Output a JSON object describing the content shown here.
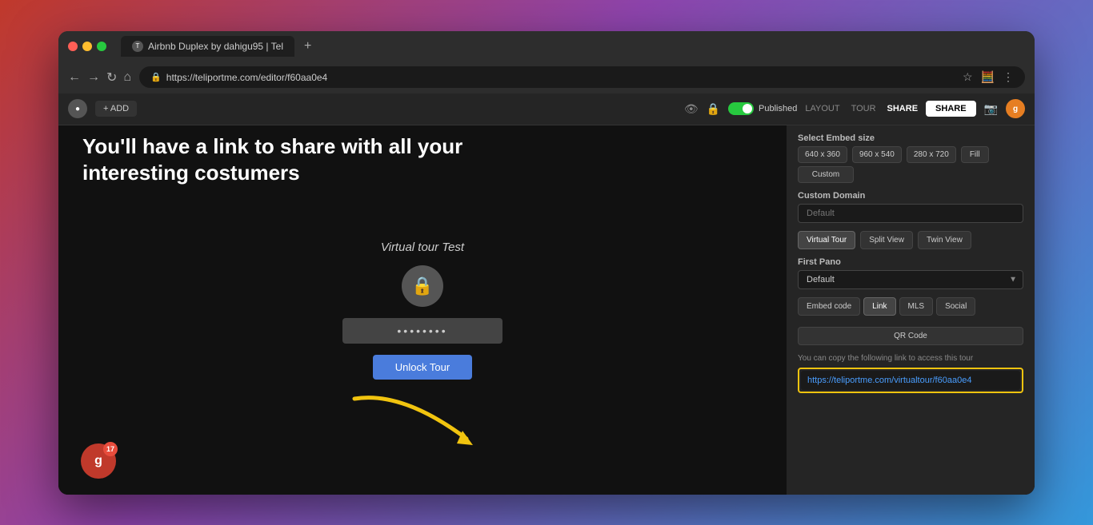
{
  "browser": {
    "tab_title": "Airbnb Duplex by dahigu95 | Tel",
    "tab_plus": "+",
    "address": "https://teliportme.com/editor/f60aa0e4"
  },
  "appbar": {
    "add_label": "+ ADD",
    "nav_links": [
      "LAYOUT",
      "TOUR",
      "SHARE"
    ],
    "active_nav": "SHARE",
    "published_label": "Published",
    "eye_icon": "👁",
    "lock_icon": "🔒",
    "camera_icon": "📷",
    "avatar_letter": "g"
  },
  "overlay": {
    "headline_line1": "You'll have a link to share with all your",
    "headline_line2": "interesting costumers"
  },
  "tour": {
    "title": "Virtual tour Test",
    "password_placeholder": "••••••••",
    "unlock_label": "Unlock Tour"
  },
  "notification": {
    "badge_count": "17"
  },
  "right_panel": {
    "embed_size_label": "Select Embed size",
    "size_640": "640 x 360",
    "size_960": "960 x 540",
    "size_280": "280 x 720",
    "size_fill": "Fill",
    "size_custom": "Custom",
    "custom_domain_label": "Custom Domain",
    "domain_placeholder": "Default",
    "view_buttons": [
      "Virtual Tour",
      "Split View",
      "Twin View"
    ],
    "active_view": "Virtual Tour",
    "first_pano_label": "First Pano",
    "pano_default": "Default",
    "tab_buttons": [
      "Embed code",
      "Link",
      "MLS",
      "Social"
    ],
    "active_tab": "Link",
    "qr_label": "QR Code",
    "info_text": "You can copy the following link to access this tour",
    "tour_link": "https://teliportme.com/virtualtour/f60aa0e4"
  }
}
